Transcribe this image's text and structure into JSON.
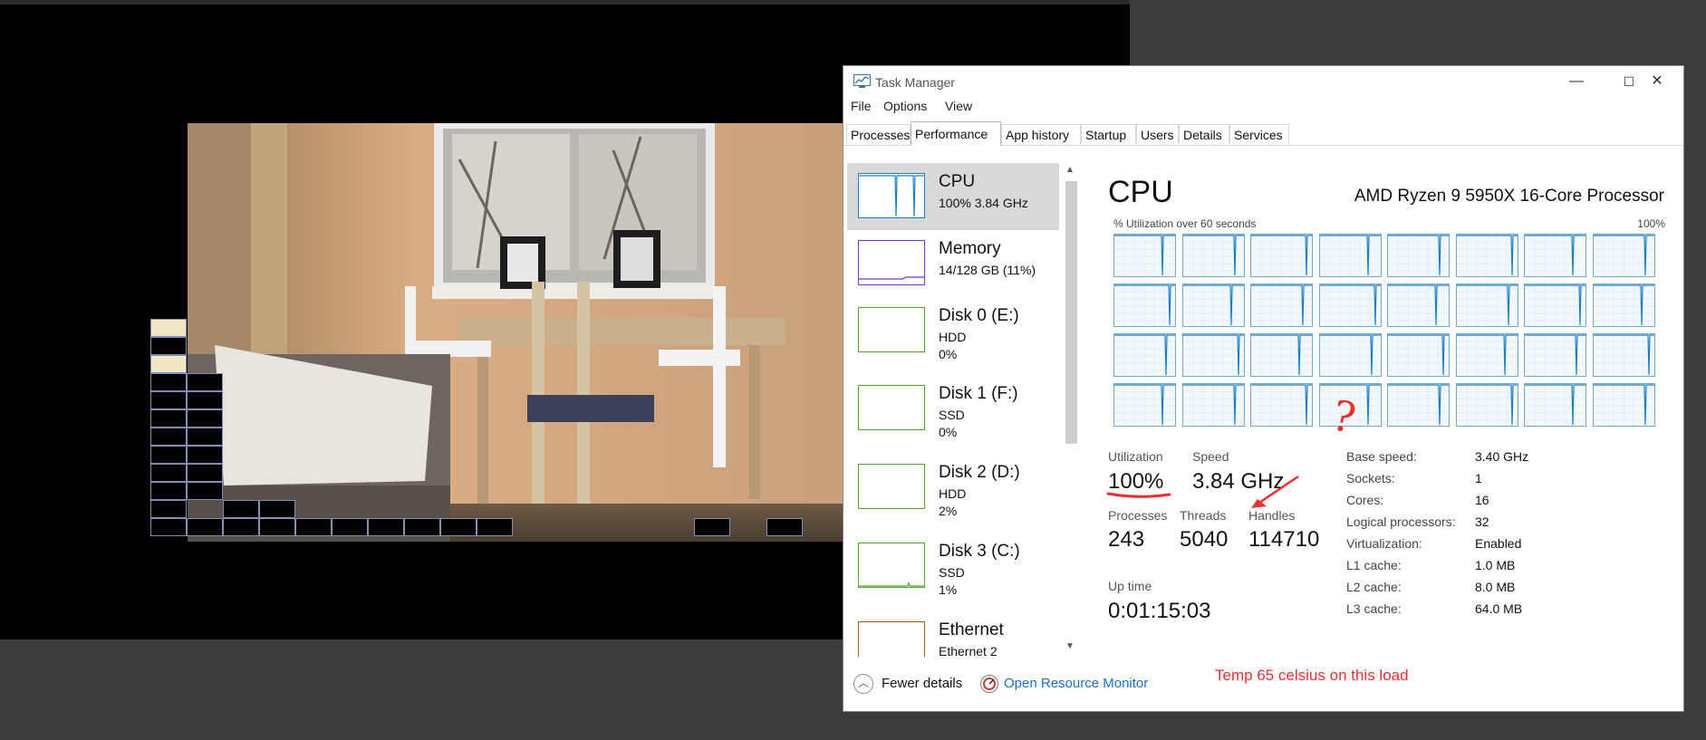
{
  "task_manager": {
    "title": "Task Manager",
    "window_controls": {
      "minimize": "—",
      "maximize": "☐",
      "close": "✕"
    },
    "menu": [
      "File",
      "Options",
      "View"
    ],
    "tabs": [
      "Processes",
      "Performance",
      "App history",
      "Startup",
      "Users",
      "Details",
      "Services"
    ],
    "active_tab": "Performance",
    "sidebar": [
      {
        "title": "CPU",
        "sub1": "100%  3.84 GHz",
        "sub2": "",
        "color": "#1a7ec5",
        "selected": true
      },
      {
        "title": "Memory",
        "sub1": "14/128 GB (11%)",
        "sub2": "",
        "color": "#8b2ec4",
        "selected": false
      },
      {
        "title": "Disk 0 (E:)",
        "sub1": "HDD",
        "sub2": "0%",
        "color": "#4ea72e",
        "selected": false
      },
      {
        "title": "Disk 1 (F:)",
        "sub1": "SSD",
        "sub2": "0%",
        "color": "#4ea72e",
        "selected": false
      },
      {
        "title": "Disk 2 (D:)",
        "sub1": "HDD",
        "sub2": "2%",
        "color": "#4ea72e",
        "selected": false
      },
      {
        "title": "Disk 3 (C:)",
        "sub1": "SSD",
        "sub2": "1%",
        "color": "#4ea72e",
        "selected": false
      },
      {
        "title": "Ethernet",
        "sub1": "Ethernet 2",
        "sub2": "",
        "color": "#a7581a",
        "selected": false
      }
    ],
    "scroll_up": "▲",
    "scroll_down": "▼",
    "cpu": {
      "heading": "CPU",
      "processor_name": "AMD Ryzen 9 5950X 16-Core Processor",
      "graph_caption": "% Utilization over 60 seconds",
      "graph_max": "100%",
      "logical_processor_graphs": 32,
      "utilization_label": "Utilization",
      "utilization_value": "100%",
      "speed_label": "Speed",
      "speed_value": "3.84 GHz",
      "processes_label": "Processes",
      "processes_value": "243",
      "threads_label": "Threads",
      "threads_value": "5040",
      "handles_label": "Handles",
      "handles_value": "114710",
      "uptime_label": "Up time",
      "uptime_value": "0:01:15:03",
      "details": [
        {
          "key": "Base speed:",
          "value": "3.40 GHz"
        },
        {
          "key": "Sockets:",
          "value": "1"
        },
        {
          "key": "Cores:",
          "value": "16"
        },
        {
          "key": "Logical processors:",
          "value": "32"
        },
        {
          "key": "Virtualization:",
          "value": "Enabled"
        },
        {
          "key": "L1 cache:",
          "value": "1.0 MB"
        },
        {
          "key": "L2 cache:",
          "value": "8.0 MB"
        },
        {
          "key": "L3 cache:",
          "value": "64.0 MB"
        }
      ]
    },
    "footer": {
      "fewer_details": "Fewer details",
      "open_resource_monitor": "Open Resource Monitor"
    }
  },
  "annotations": {
    "question_mark": "?",
    "temp_note": "Temp 65 celsius on this load",
    "ink_color": "#e8312f"
  },
  "colors": {
    "cpu_graph": "#1a7ec5",
    "link": "#1a6fd0"
  }
}
